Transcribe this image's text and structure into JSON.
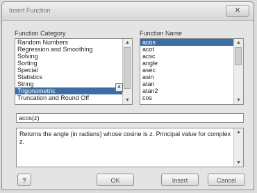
{
  "window": {
    "title": "Insert Function",
    "close_label": "✕"
  },
  "category": {
    "label": "Function Category",
    "items": [
      "Random Numbers",
      "Regression and Smoothing",
      "Solving",
      "Sorting",
      "Special",
      "Statistics",
      "String",
      "Trigonometric",
      "Truncation and Round Off"
    ],
    "selected_index": 7,
    "marker": "a"
  },
  "function": {
    "label": "Function Name",
    "items": [
      "acos",
      "acot",
      "acsc",
      "angle",
      "asec",
      "asin",
      "atan",
      "atan2",
      "cos"
    ],
    "selected_index": 0
  },
  "formula": "acos(z)",
  "description": "Returns the angle (in radians) whose cosine is z. Principal value for complex z.",
  "buttons": {
    "help": "?",
    "ok": "OK",
    "insert": "Insert",
    "cancel": "Cancel"
  },
  "colors": {
    "selection": "#3b6ea5"
  }
}
